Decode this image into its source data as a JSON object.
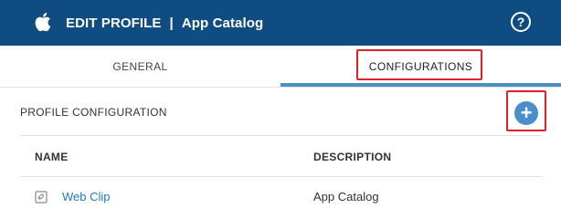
{
  "header": {
    "icon": "apple-logo-icon",
    "title": "EDIT PROFILE",
    "separator": "|",
    "subtitle": "App Catalog",
    "help_icon": "help-icon",
    "help_glyph": "?",
    "background": "#0f4c81"
  },
  "tabs": [
    {
      "label": "GENERAL",
      "active": false
    },
    {
      "label": "CONFIGURATIONS",
      "active": true
    }
  ],
  "section": {
    "title": "PROFILE CONFIGURATION",
    "add_icon": "plus-icon",
    "add_glyph": "+"
  },
  "table": {
    "columns": [
      "NAME",
      "DESCRIPTION"
    ],
    "rows": [
      {
        "icon": "web-clip-icon",
        "name": "Web Clip",
        "description": "App Catalog"
      }
    ]
  },
  "colors": {
    "accent": "#4a90c2",
    "link": "#1f77c0",
    "highlight": "#e0202a"
  }
}
